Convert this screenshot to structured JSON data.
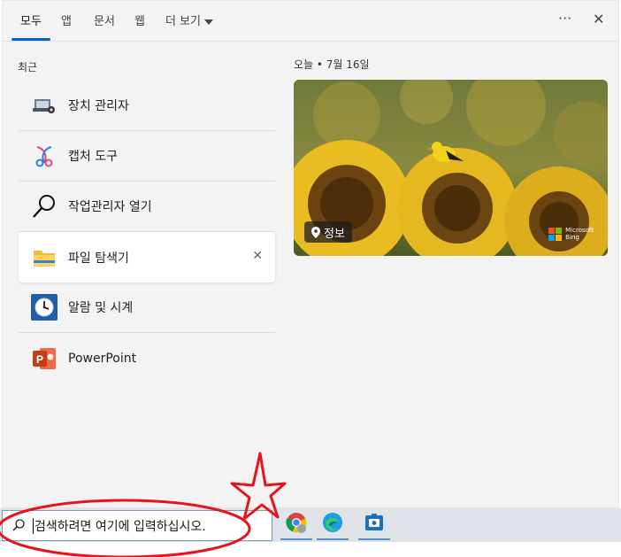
{
  "tabs": [
    {
      "label": "모두"
    },
    {
      "label": "앱"
    },
    {
      "label": "문서"
    },
    {
      "label": "웹"
    },
    {
      "label": "더 보기"
    }
  ],
  "top_actions": {
    "more_icon": "more-horizontal-icon",
    "close_icon": "close-icon",
    "more_glyph": "···",
    "close_glyph": "✕"
  },
  "recent": {
    "title": "최근",
    "items": [
      {
        "label": "장치 관리자",
        "icon": "device-manager-icon"
      },
      {
        "label": "캡처 도구",
        "icon": "snipping-tool-icon"
      },
      {
        "label": "작업관리자 열기",
        "icon": "search-icon"
      },
      {
        "label": "파일 탐색기",
        "icon": "file-explorer-icon",
        "close": "✕"
      },
      {
        "label": "알람 및 시계",
        "icon": "clock-icon"
      },
      {
        "label": "PowerPoint",
        "icon": "powerpoint-icon"
      }
    ]
  },
  "today": {
    "title": "오늘 • 7월 16일",
    "info_label": "정보",
    "brand_line1": "Microsoft",
    "brand_line2": "Bing"
  },
  "search": {
    "placeholder": "검색하려면 여기에 입력하십시오."
  },
  "taskbar_apps": [
    {
      "name": "chrome"
    },
    {
      "name": "edge"
    },
    {
      "name": "store-app"
    }
  ],
  "colors": {
    "accent": "#0067c0",
    "annotation_red": "#e8141c"
  }
}
